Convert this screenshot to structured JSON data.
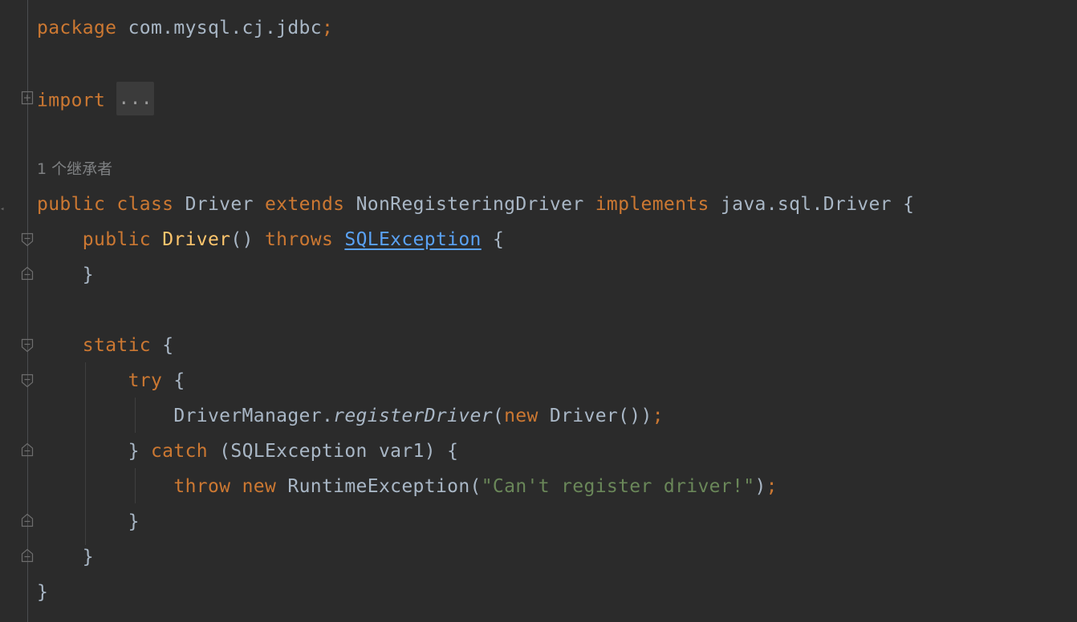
{
  "code": {
    "line1": {
      "kw": "package",
      "rest": " com.mysql.cj.jdbc",
      "semi": ";"
    },
    "line2": {
      "kw": "import",
      "folded": "..."
    },
    "hint": "1 个继承者",
    "line3": {
      "kw1": "public",
      "kw2": "class",
      "name": "Driver",
      "kw3": "extends",
      "super": "NonRegisteringDriver",
      "kw4": "implements",
      "iface": "java.sql.Driver",
      "brace": "{"
    },
    "line4": {
      "kw1": "public",
      "ctor": "Driver",
      "parens": "()",
      "kw2": "throws",
      "exc": "SQLException",
      "brace": "{"
    },
    "line5": {
      "brace": "}"
    },
    "line6": {
      "kw": "static",
      "brace": "{"
    },
    "line7": {
      "kw": "try",
      "brace": "{"
    },
    "line8": {
      "obj": "DriverManager.",
      "method": "registerDriver",
      "open": "(",
      "kw": "new",
      "call": "Driver())",
      "semi": ";"
    },
    "line9": {
      "close": "}",
      "kw": "catch",
      "params": "(SQLException var1) {"
    },
    "line10": {
      "kw1": "throw",
      "kw2": "new",
      "cls": "RuntimeException(",
      "str": "\"Can't register driver!\"",
      "close": ")",
      "semi": ";"
    },
    "line11": {
      "brace": "}"
    },
    "line12": {
      "brace": "}"
    },
    "line13": {
      "brace": "}"
    }
  },
  "icons": [
    "fold-open-icon",
    "fold-close-icon",
    "fold-collapsed-icon"
  ],
  "colors": {
    "background": "#2b2b2b",
    "keyword": "#cc7832",
    "text": "#a9b7c6",
    "function": "#ffc66d",
    "string": "#6a8759",
    "link": "#5aa2f5",
    "hint": "#7f8183"
  }
}
